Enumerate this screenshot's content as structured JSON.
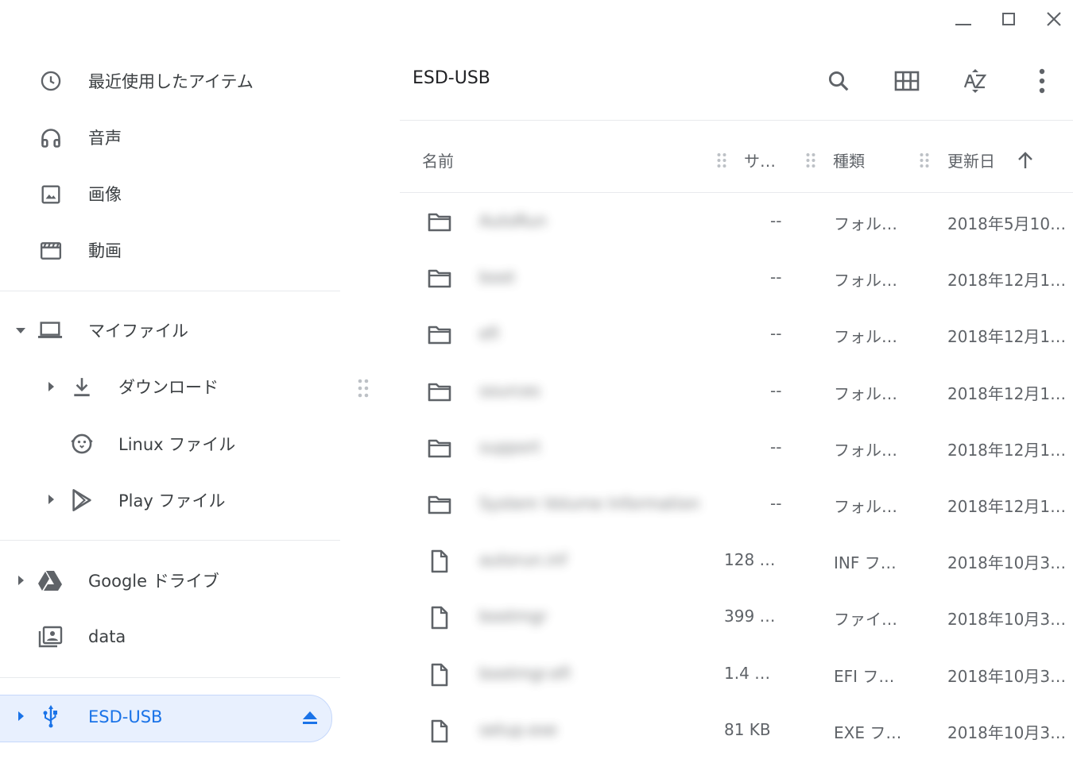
{
  "window": {
    "minimize_icon": "minimize-icon",
    "maximize_icon": "maximize-icon",
    "close_icon": "close-icon"
  },
  "sidebar": {
    "recent": "最近使用したアイテム",
    "audio": "音声",
    "images": "画像",
    "videos": "動画",
    "my_files": "マイファイル",
    "downloads": "ダウンロード",
    "linux_files": "Linux ファイル",
    "play_files": "Play ファイル",
    "google_drive": "Google ドライブ",
    "data": "data",
    "usb": "ESD-USB"
  },
  "header": {
    "title": "ESD-USB"
  },
  "columns": {
    "name": "名前",
    "size": "サ…",
    "type": "種類",
    "modified": "更新日"
  },
  "files": [
    {
      "name": "AutoRun",
      "size": "--",
      "type": "フォル…",
      "date": "2018年5月10…",
      "icon": "folder-icon"
    },
    {
      "name": "boot",
      "size": "--",
      "type": "フォル…",
      "date": "2018年12月1…",
      "icon": "folder-icon"
    },
    {
      "name": "efi",
      "size": "--",
      "type": "フォル…",
      "date": "2018年12月1…",
      "icon": "folder-icon"
    },
    {
      "name": "sources",
      "size": "--",
      "type": "フォル…",
      "date": "2018年12月1…",
      "icon": "folder-icon"
    },
    {
      "name": "support",
      "size": "--",
      "type": "フォル…",
      "date": "2018年12月1…",
      "icon": "folder-icon"
    },
    {
      "name": "System Volume Information",
      "size": "--",
      "type": "フォル…",
      "date": "2018年12月1…",
      "icon": "folder-icon"
    },
    {
      "name": "autorun.inf",
      "size": "128 …",
      "type": "INF フ…",
      "date": "2018年10月3…",
      "icon": "file-icon"
    },
    {
      "name": "bootmgr",
      "size": "399 …",
      "type": "ファイ…",
      "date": "2018年10月3…",
      "icon": "file-icon"
    },
    {
      "name": "bootmgr.efi",
      "size": "1.4 …",
      "type": "EFI フ…",
      "date": "2018年10月3…",
      "icon": "file-icon"
    },
    {
      "name": "setup.exe",
      "size": "81 KB",
      "type": "EXE フ…",
      "date": "2018年10月3…",
      "icon": "file-icon"
    }
  ]
}
